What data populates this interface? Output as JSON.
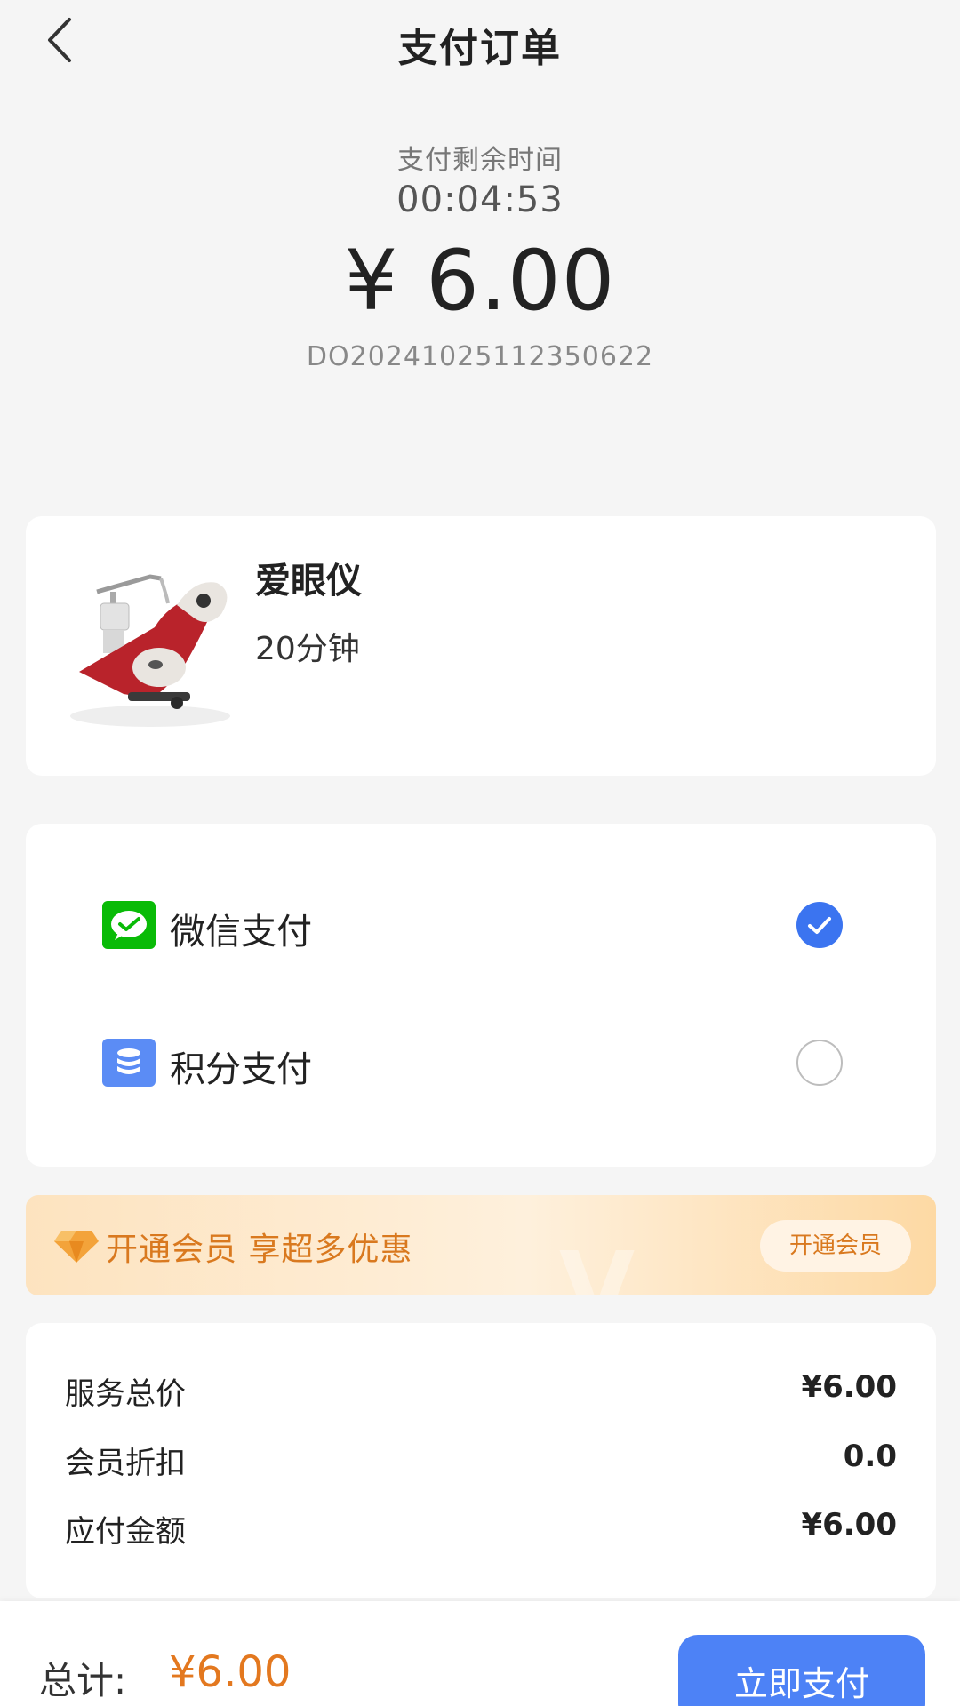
{
  "header": {
    "title": "支付订单",
    "back_icon": "chevron-left-icon"
  },
  "countdown": {
    "label": "支付剩余时间",
    "time": "00:04:53"
  },
  "amount": "¥ 6.00",
  "order_number": "DO20241025112350622",
  "product": {
    "name": "爱眼仪",
    "duration": "20分钟",
    "image_icon": "eye-care-massage-chair-image"
  },
  "payment_methods": [
    {
      "label": "微信支付",
      "icon": "wechat-pay-icon",
      "selected": true
    },
    {
      "label": "积分支付",
      "icon": "points-coin-icon",
      "selected": false
    }
  ],
  "membership": {
    "text": "开通会员 享超多优惠",
    "button_label": "开通会员",
    "icon": "diamond-icon"
  },
  "summary": [
    {
      "label": "服务总价",
      "value": "¥6.00"
    },
    {
      "label": "会员折扣",
      "value": "0.0"
    },
    {
      "label": "应付金额",
      "value": "¥6.00"
    }
  ],
  "bottom_bar": {
    "total_label": "总计:",
    "total_value": "¥6.00",
    "pay_button": "立即支付"
  },
  "colors": {
    "accent_blue": "#4d82f6",
    "check_blue": "#3b74f0",
    "orange": "#e3781f",
    "wechat_green": "#09bb07",
    "points_blue": "#5b8cf5"
  }
}
